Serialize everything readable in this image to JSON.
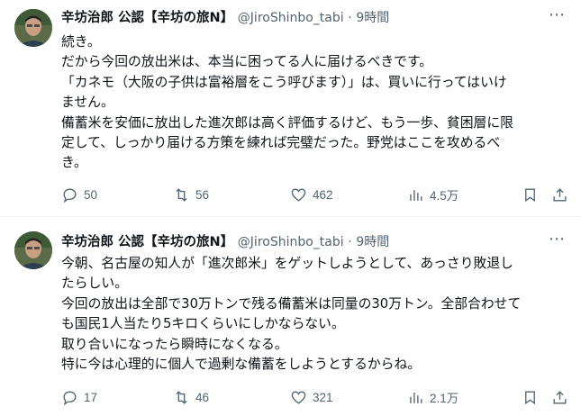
{
  "tweets": [
    {
      "author": {
        "name": "辛坊治郎 公認【辛坊の旅N】",
        "handle": "@JiroShinbo_tabi",
        "separator": "·",
        "time": "9時間"
      },
      "lines": [
        "続き。",
        "だから今回の放出米は、本当に困ってる人に届けるべきです。",
        "「カネモ（大阪の子供は富裕層をこう呼びます）」は、買いに行ってはいけ",
        "ません。",
        "備蓄米を安価に放出した進次郎は高く評価するけど、もう一歩、貧困層に限",
        "定して、しっかり届ける方策を練れば完璧だった。野党はここを攻めるべ",
        "き。"
      ],
      "stats": {
        "replies": "50",
        "reposts": "56",
        "likes": "462",
        "views": "4.5万"
      }
    },
    {
      "author": {
        "name": "辛坊治郎 公認【辛坊の旅N】",
        "handle": "@JiroShinbo_tabi",
        "separator": "·",
        "time": "9時間"
      },
      "lines": [
        "今朝、名古屋の知人が「進次郎米」をゲットしようとして、あっさり敗退し",
        "たらしい。",
        "今回の放出は全部で30万トンで残る備蓄米は同量の30万トン。全部合わせて",
        "も国民1人当たり5キロくらいにしかならない。",
        "取り合いになったら瞬時になくなる。",
        "特に今は心理的に個人で過剰な備蓄をしようとするからね。"
      ],
      "stats": {
        "replies": "17",
        "reposts": "46",
        "likes": "321",
        "views": "2.1万"
      }
    }
  ],
  "icons": {
    "reply": "speech-bubble-icon",
    "repost": "repost-arrows-icon",
    "like": "heart-icon",
    "views": "bar-chart-icon",
    "bookmark": "bookmark-icon",
    "share": "share-upload-icon",
    "more": "more-dots-icon"
  },
  "colors": {
    "text": "#0f1419",
    "secondary": "#536471",
    "divider": "#eff3f4"
  }
}
